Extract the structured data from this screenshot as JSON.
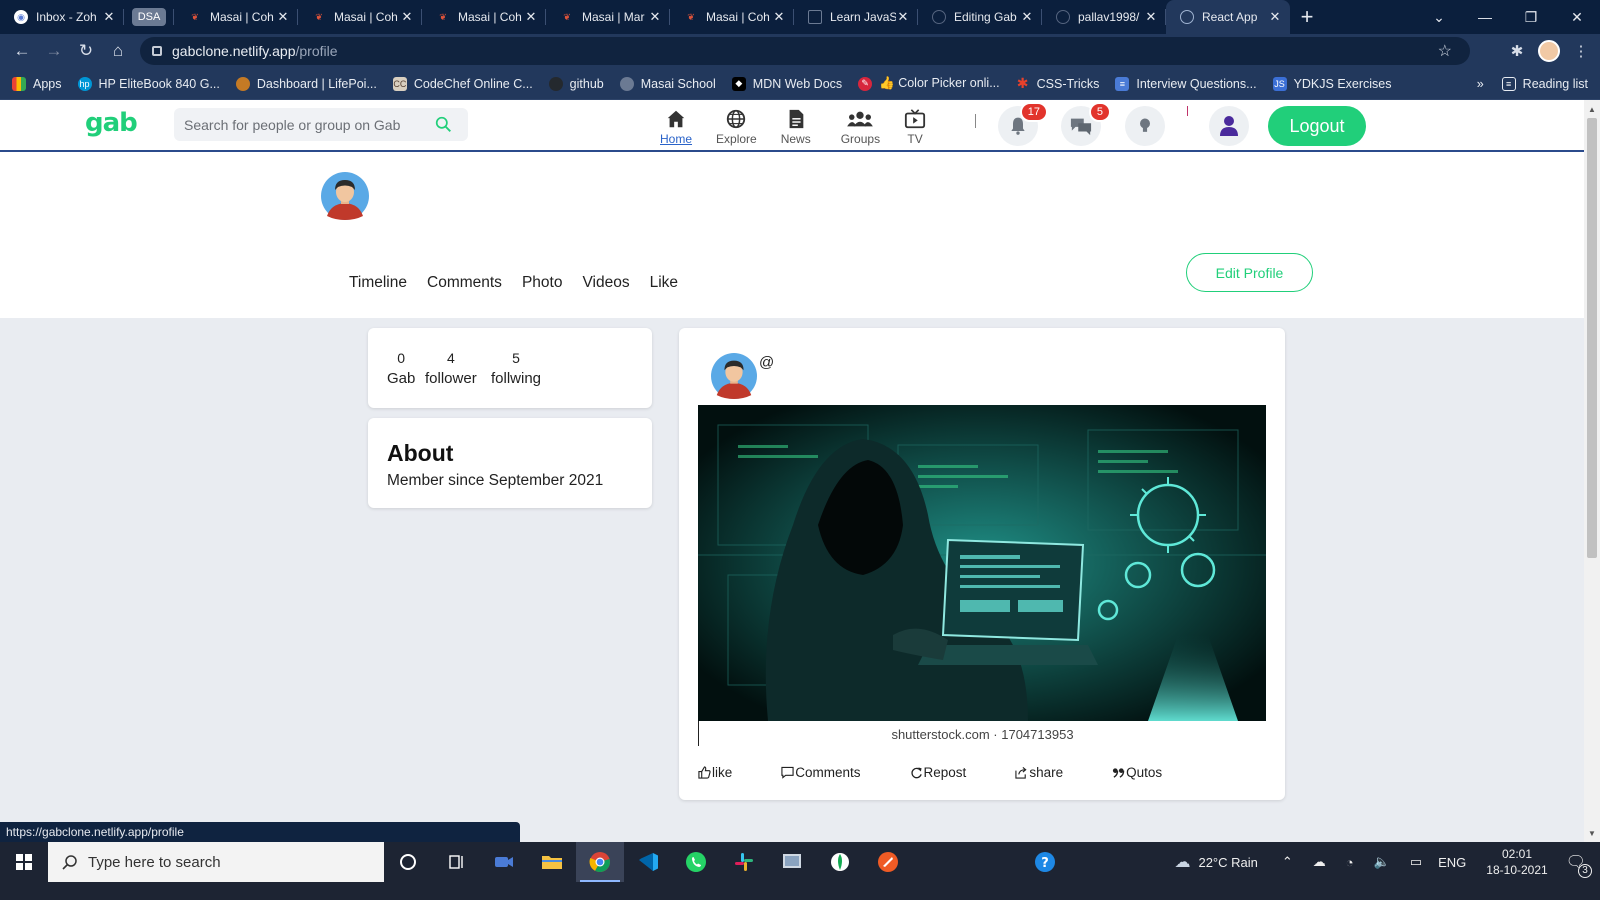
{
  "browser": {
    "tabs": [
      {
        "title": "Inbox - Zoh",
        "icon": "zoho-mail-icon",
        "color": "#5a7cd6"
      },
      {
        "title": "DSA",
        "icon": "dsa-group-chip"
      },
      {
        "title": "Masai | Coh",
        "icon": "masai-icon",
        "color": "#e0533a"
      },
      {
        "title": "Masai | Coh",
        "icon": "masai-icon",
        "color": "#e0533a"
      },
      {
        "title": "Masai | Coh",
        "icon": "masai-icon",
        "color": "#e0533a"
      },
      {
        "title": "Masai | Mar",
        "icon": "masai-icon",
        "color": "#e0533a"
      },
      {
        "title": "Masai | Coh",
        "icon": "masai-icon",
        "color": "#e0533a"
      },
      {
        "title": "Learn JavaS",
        "icon": "page-icon",
        "color": "#6b7a93"
      },
      {
        "title": "Editing Gab",
        "icon": "github-icon",
        "color": "#0b1f3d"
      },
      {
        "title": "pallav1998/",
        "icon": "github-icon",
        "color": "#0b1f3d"
      },
      {
        "title": "React App",
        "icon": "globe-icon",
        "color": "#9fb3d1",
        "active": true
      }
    ],
    "url_host": "gabclone.netlify.app",
    "url_path": "/profile",
    "bookmarks": [
      {
        "label": "Apps",
        "icon": "apps-grid-icon",
        "color": "#e94235"
      },
      {
        "label": "HP EliteBook 840 G...",
        "icon": "hp-icon",
        "color": "#0096d6"
      },
      {
        "label": "Dashboard | LifePoi...",
        "icon": "lifepoints-icon",
        "color": "#c47a25"
      },
      {
        "label": "CodeChef Online C...",
        "icon": "codechef-icon",
        "color": "#5b4638"
      },
      {
        "label": "github",
        "icon": "github-icon",
        "color": "#24292e"
      },
      {
        "label": "Masai School",
        "icon": "masai-icon",
        "color": "#6b7a93"
      },
      {
        "label": "MDN Web Docs",
        "icon": "mdn-icon",
        "color": "#000000"
      },
      {
        "label": "👍 Color Picker onli...",
        "icon": "color-picker-icon",
        "color": "#d7263d"
      },
      {
        "label": "CSS-Tricks",
        "icon": "css-tricks-icon",
        "color": "#e8412b"
      },
      {
        "label": "Interview Questions...",
        "icon": "doc-icon",
        "color": "#4a7bd6"
      },
      {
        "label": "YDKJS Exercises",
        "icon": "js-icon",
        "color": "#3b6fd6"
      }
    ],
    "bookmarks_overflow": "»",
    "reading_list": "Reading list",
    "status_url": "https://gabclone.netlify.app/profile"
  },
  "app": {
    "logo": "gab",
    "search_placeholder": "Search for people or group on Gab",
    "nav": [
      {
        "label": "Home",
        "icon": "home-icon",
        "active": true
      },
      {
        "label": "Explore",
        "icon": "globe-icon"
      },
      {
        "label": "News",
        "icon": "news-icon"
      },
      {
        "label": "Groups",
        "icon": "groups-icon"
      },
      {
        "label": "TV",
        "icon": "tv-icon"
      }
    ],
    "notifications_count": "17",
    "messages_count": "5",
    "logout_label": "Logout",
    "brand_color": "#21cf7a"
  },
  "profile": {
    "tabs": [
      "Timeline",
      "Comments",
      "Photo",
      "Videos",
      "Like"
    ],
    "edit_label": "Edit Profile",
    "stats": [
      {
        "value": "0",
        "label": "Gab"
      },
      {
        "value": "4",
        "label": "follower"
      },
      {
        "value": "5",
        "label": "follwing"
      }
    ],
    "about_title": "About",
    "about_text": "Member since September 2021"
  },
  "post": {
    "handle": "@",
    "image_credit": "shutterstock.com · 1704713953",
    "actions": [
      {
        "label": "like",
        "icon": "thumbs-up-icon"
      },
      {
        "label": "Comments",
        "icon": "comment-icon"
      },
      {
        "label": "Repost",
        "icon": "repost-icon"
      },
      {
        "label": "share",
        "icon": "share-icon"
      },
      {
        "label": "Qutos",
        "icon": "quote-icon"
      }
    ]
  },
  "taskbar": {
    "search_placeholder": "Type here to search",
    "weather": "22°C  Rain",
    "language": "ENG",
    "time": "02:01",
    "date": "18-10-2021",
    "notification_count": "3"
  }
}
